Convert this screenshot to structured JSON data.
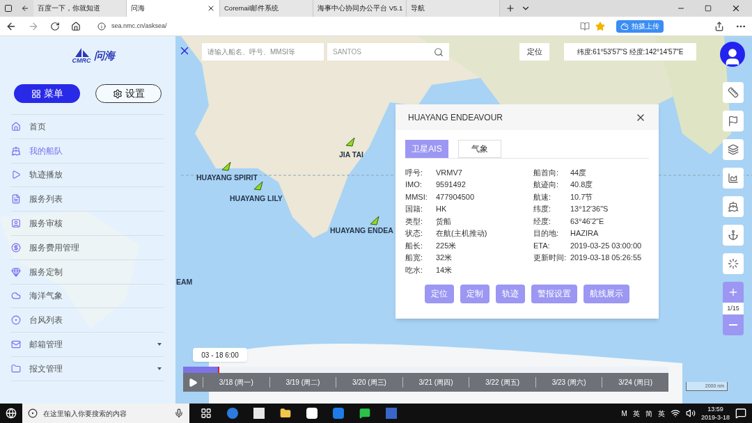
{
  "browser": {
    "tabs": [
      {
        "label": "百度一下，你就知道",
        "selected": false
      },
      {
        "label": "问海",
        "selected": true
      },
      {
        "label": "Coremail邮件系统",
        "selected": false
      },
      {
        "label": "海事中心协同办公平台 V5.1",
        "selected": false
      },
      {
        "label": "导航",
        "selected": false
      }
    ],
    "url": "sea.nmc.cn/asksea/",
    "extension_button": "拍摄上传"
  },
  "sidebar": {
    "logo_mark": "CMRC",
    "logo_text": "问海",
    "buttons": [
      {
        "label": "菜单",
        "selected": true
      },
      {
        "label": "设置",
        "selected": false
      }
    ],
    "items": [
      {
        "label": "首页",
        "selected": false,
        "expandable": false
      },
      {
        "label": "我的船队",
        "selected": true,
        "expandable": false
      },
      {
        "label": "轨迹播放",
        "selected": false,
        "expandable": false
      },
      {
        "label": "服务列表",
        "selected": false,
        "expandable": false
      },
      {
        "label": "服务审核",
        "selected": false,
        "expandable": false
      },
      {
        "label": "服务费用管理",
        "selected": false,
        "expandable": false
      },
      {
        "label": "服务定制",
        "selected": false,
        "expandable": false
      },
      {
        "label": "海洋气象",
        "selected": false,
        "expandable": false
      },
      {
        "label": "台风列表",
        "selected": false,
        "expandable": false
      },
      {
        "label": "邮箱管理",
        "selected": false,
        "expandable": true
      },
      {
        "label": "报文管理",
        "selected": false,
        "expandable": true
      }
    ]
  },
  "map": {
    "search": {
      "placeholder": "请输入船名、呼号、MMSI等"
    },
    "ship_search": {
      "placeholder": "SANTOS"
    },
    "locate_button": "定位",
    "coordinates": "纬度:61°53'57\"S 经度:142°14'57\"E",
    "ships": [
      {
        "name": "HUAYANG SPIRIT"
      },
      {
        "name": "HUAYANG LILY"
      },
      {
        "name": "JIA TAI"
      },
      {
        "name": "HUAYANG ENDEA"
      },
      {
        "name": "EAM"
      }
    ],
    "zoom": "1/15"
  },
  "popup": {
    "title": "HUAYANG ENDEAVOUR",
    "tabs": [
      {
        "label": "卫星AIS",
        "selected": true
      },
      {
        "label": "气象",
        "selected": false
      }
    ],
    "left_fields": [
      {
        "label": "呼号:",
        "value": "VRMV7"
      },
      {
        "label": "IMO:",
        "value": "9591492"
      },
      {
        "label": "MMSI:",
        "value": "477904500"
      },
      {
        "label": "国籍:",
        "value": "HK"
      },
      {
        "label": "类型:",
        "value": "货船"
      },
      {
        "label": "状态:",
        "value": "在航(主机推动)"
      },
      {
        "label": "船长:",
        "value": "225米"
      },
      {
        "label": "船宽:",
        "value": "32米"
      },
      {
        "label": "吃水:",
        "value": "14米"
      }
    ],
    "right_fields": [
      {
        "label": "船首向:",
        "value": "44度"
      },
      {
        "label": "航迹向:",
        "value": "40.8度"
      },
      {
        "label": "航速:",
        "value": "10.7节"
      },
      {
        "label": "纬度:",
        "value": "13°12'36\"S"
      },
      {
        "label": "经度:",
        "value": "63°46'2\"E"
      },
      {
        "label": "目的地:",
        "value": "HAZIRA"
      },
      {
        "label": "ETA:",
        "value": "2019-03-25 03:00:00"
      },
      {
        "label": "更新时间:",
        "value": "2019-03-18 05:26:55"
      }
    ],
    "buttons": [
      "定位",
      "定制",
      "轨迹",
      "警报设置",
      "航线展示"
    ]
  },
  "timeline": {
    "tooltip": "03 - 18 6:00",
    "level": 0.075,
    "days": [
      "3/18 (周一)",
      "3/19 (周二)",
      "3/20 (周三)",
      "3/21 (周四)",
      "3/22 (周五)",
      "3/23 (周六)",
      "3/24 (周日)"
    ],
    "scale": "2000 nm"
  },
  "taskbar": {
    "search": {
      "placeholder": "在这里输入你要搜索的内容"
    },
    "tray": [
      "M",
      "英",
      "简",
      "英"
    ],
    "time": "13:59",
    "date": "2019-3-18"
  }
}
